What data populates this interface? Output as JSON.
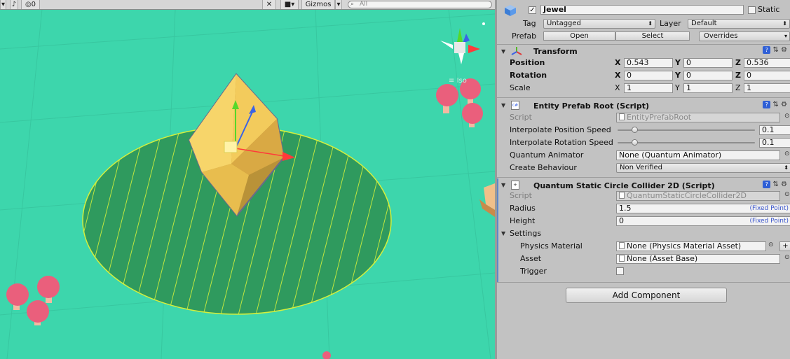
{
  "scene_toolbar": {
    "visibility_count": "0",
    "gizmos_label": "Gizmos",
    "search_placeholder": "All",
    "iso_label": "Iso"
  },
  "object_header": {
    "active_checked": true,
    "name": "Jewel",
    "static_label": "Static",
    "tag_label": "Tag",
    "tag_value": "Untagged",
    "layer_label": "Layer",
    "layer_value": "Default",
    "prefab_label": "Prefab",
    "open_label": "Open",
    "select_label": "Select",
    "overrides_label": "Overrides"
  },
  "transform": {
    "title": "Transform",
    "position_label": "Position",
    "rotation_label": "Rotation",
    "scale_label": "Scale",
    "axis_x": "X",
    "axis_y": "Y",
    "axis_z": "Z",
    "position": {
      "x": "0.543",
      "y": "0",
      "z": "0.536"
    },
    "rotation": {
      "x": "0",
      "y": "0",
      "z": "0"
    },
    "scale": {
      "x": "1",
      "y": "1",
      "z": "1"
    }
  },
  "entity_prefab_root": {
    "title": "Entity Prefab Root (Script)",
    "script_label": "Script",
    "script_value": "EntityPrefabRoot",
    "interp_pos_label": "Interpolate Position Speed",
    "interp_pos_value": "0.1",
    "interp_pos_fraction": 0.12,
    "interp_rot_label": "Interpolate Rotation Speed",
    "interp_rot_value": "0.1",
    "interp_rot_fraction": 0.12,
    "animator_label": "Quantum Animator",
    "animator_value": "None (Quantum Animator)",
    "create_label": "Create Behaviour",
    "create_value": "Non Verified"
  },
  "collider": {
    "title": "Quantum Static Circle Collider 2D (Script)",
    "script_label": "Script",
    "script_value": "QuantumStaticCircleCollider2D",
    "radius_label": "Radius",
    "radius_value": "1.5",
    "height_label": "Height",
    "height_value": "0",
    "fixed_point": "(Fixed Point)",
    "settings_label": "Settings",
    "physics_material_label": "Physics Material",
    "physics_material_value": "None (Physics Material Asset)",
    "asset_label": "Asset",
    "asset_value": "None (Asset Base)",
    "trigger_label": "Trigger",
    "trigger_checked": false
  },
  "add_component_label": "Add Component",
  "colors": {
    "scene_ground": "#3dd6ac",
    "collider_fill": "#2f9a5e",
    "collider_wire": "#d4ef3c",
    "jewel": "#f3cf62",
    "mushroom": "#ea5f7c",
    "inspector_bg": "#c2c2c2",
    "fixed_point_text": "#3a55cc"
  }
}
